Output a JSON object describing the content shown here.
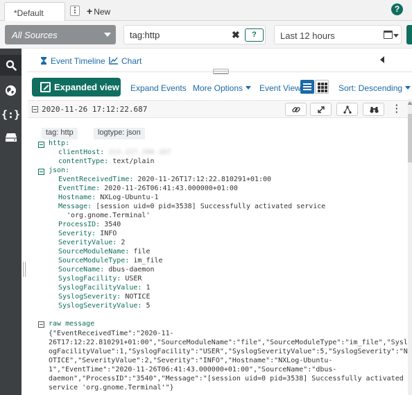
{
  "tabs": {
    "active": "*Default",
    "menu_glyph": "⋮",
    "new_label": "New"
  },
  "help_glyph": "?",
  "filter": {
    "source": "All Sources",
    "query": "tag:http",
    "query_help": "?",
    "time_range": "Last 12 hours"
  },
  "view_tabs": {
    "timeline": "Event Timeline",
    "chart": "Chart"
  },
  "toolbar": {
    "expanded_view": "Expanded view",
    "expand_events": "Expand Events",
    "more_options": "More Options",
    "event_view": "Event View",
    "sort": "Sort: Descending"
  },
  "event": {
    "timestamp": "2020-11-26 17:12:22.687",
    "tags": [
      {
        "key": "tag:",
        "value": "http"
      },
      {
        "key": "logtype:",
        "value": "json"
      }
    ],
    "http": {
      "label": "http:",
      "clientHost_key": "clientHost:",
      "clientHost_value": "213.227.206.167",
      "contentType_key": "contentType:",
      "contentType_value": "text/plain"
    },
    "json": {
      "label": "json:",
      "fields": [
        {
          "key": "EventReceivedTime:",
          "value": "2020-11-26T17:12:22.810291+01:00"
        },
        {
          "key": "EventTime:",
          "value": "2020-11-26T06:41:43.000000+01:00"
        },
        {
          "key": "Hostname:",
          "value": "NXLog-Ubuntu-1"
        },
        {
          "key": "Message:",
          "value": "[session uid=0 pid=3538] Successfully activated service"
        },
        {
          "key": "",
          "value": "'org.gnome.Terminal'"
        },
        {
          "key": "ProcessID:",
          "value": "3540"
        },
        {
          "key": "Severity:",
          "value": "INFO"
        },
        {
          "key": "SeverityValue:",
          "value": "2"
        },
        {
          "key": "SourceModuleName:",
          "value": "file"
        },
        {
          "key": "SourceModuleType:",
          "value": "im_file"
        },
        {
          "key": "SourceName:",
          "value": "dbus-daemon"
        },
        {
          "key": "SyslogFacility:",
          "value": "USER"
        },
        {
          "key": "SyslogFacilityValue:",
          "value": "1"
        },
        {
          "key": "SyslogSeverity:",
          "value": "NOTICE"
        },
        {
          "key": "SyslogSeverityValue:",
          "value": "5"
        }
      ]
    },
    "raw": {
      "label": "raw message",
      "lines": [
        "{\"EventReceivedTime\":\"2020-11-",
        "26T17:12:22.810291+01:00\",\"SourceModuleName\":\"file\",\"SourceModuleType\":\"im_file\",\"Sysl",
        "ogFacilityValue\":1,\"SyslogFacility\":\"USER\",\"SyslogSeverityValue\":5,\"SyslogSeverity\":\"N",
        "OTICE\",\"SeverityValue\":2,\"Severity\":\"INFO\",\"Hostname\":\"NXLog-Ubuntu-",
        "1\",\"EventTime\":\"2020-11-26T06:41:43.000000+01:00\",\"SourceName\":\"dbus-",
        "daemon\",\"ProcessID\":\"3540\",\"Message\":\"[session uid=0 pid=3538] Successfully activated",
        "service 'org.gnome.Terminal'\"}"
      ]
    }
  },
  "colors": {
    "accent": "#0f6e5f",
    "link": "#1b6aa8",
    "sidebar": "#3c4043"
  }
}
